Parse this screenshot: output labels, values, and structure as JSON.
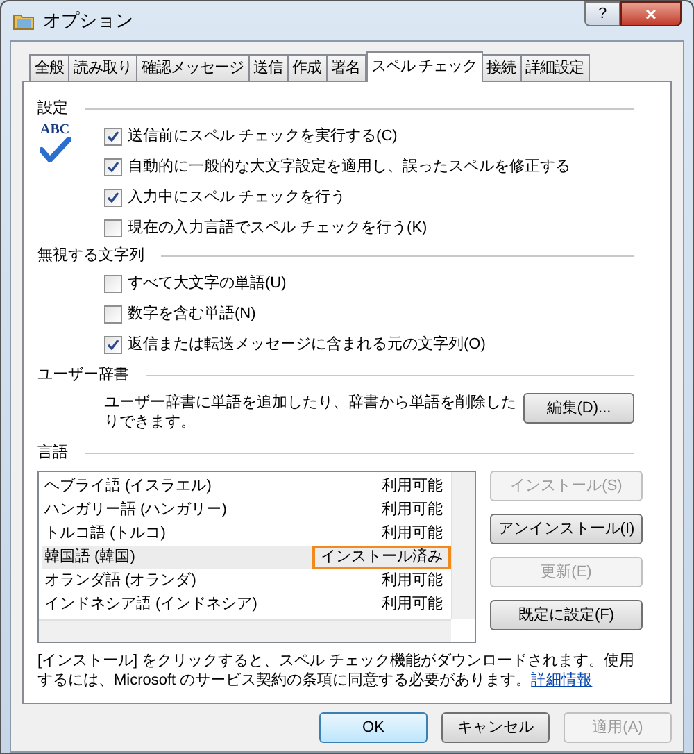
{
  "window": {
    "title": "オプション",
    "help": "?",
    "close": "×"
  },
  "tabs": [
    {
      "label": "全般",
      "selected": false
    },
    {
      "label": "読み取り",
      "selected": false
    },
    {
      "label": "確認メッセージ",
      "selected": false
    },
    {
      "label": "送信",
      "selected": false
    },
    {
      "label": "作成",
      "selected": false
    },
    {
      "label": "署名",
      "selected": false
    },
    {
      "label": "スペル チェック",
      "selected": true
    },
    {
      "label": "接続",
      "selected": false
    },
    {
      "label": "詳細設定",
      "selected": false
    }
  ],
  "settings": {
    "heading": "設定",
    "logo": "ABC",
    "options": [
      {
        "label": "送信前にスペル チェックを実行する(C)",
        "checked": true
      },
      {
        "label": "自動的に一般的な大文字設定を適用し、誤ったスペルを修正する",
        "checked": true
      },
      {
        "label": "入力中にスペル チェックを行う",
        "checked": true
      },
      {
        "label": "現在の入力言語でスペル チェックを行う(K)",
        "checked": false
      }
    ]
  },
  "ignore": {
    "heading": "無視する文字列",
    "options": [
      {
        "label": "すべて大文字の単語(U)",
        "checked": false
      },
      {
        "label": "数字を含む単語(N)",
        "checked": false
      },
      {
        "label": "返信または転送メッセージに含まれる元の文字列(O)",
        "checked": true
      }
    ]
  },
  "user_dictionary": {
    "heading": "ユーザー辞書",
    "description": "ユーザー辞書に単語を追加したり、辞書から単語を削除したりできます。",
    "button": "編集(D)..."
  },
  "languages": {
    "heading": "言語",
    "rows": [
      {
        "name": "ヘブライ語 (イスラエル)",
        "status": "利用可能",
        "selected": false,
        "annotated": false
      },
      {
        "name": "ハンガリー語 (ハンガリー)",
        "status": "利用可能",
        "selected": false,
        "annotated": false
      },
      {
        "name": "トルコ語 (トルコ)",
        "status": "利用可能",
        "selected": false,
        "annotated": false
      },
      {
        "name": "韓国語 (韓国)",
        "status": "インストール済み",
        "selected": true,
        "annotated": true
      },
      {
        "name": "オランダ語 (オランダ)",
        "status": "利用可能",
        "selected": false,
        "annotated": false
      },
      {
        "name": "インドネシア語 (インドネシア)",
        "status": "利用可能",
        "selected": false,
        "annotated": false
      }
    ],
    "buttons": [
      {
        "label": "インストール(S)",
        "disabled": true
      },
      {
        "label": "アンインストール(I)",
        "disabled": false
      },
      {
        "label": "更新(E)",
        "disabled": true
      },
      {
        "label": "既定に設定(F)",
        "disabled": false
      }
    ],
    "note": "[インストール] をクリックすると、スペル チェック機能がダウンロードされます。使用するには、Microsoft のサービス契約の条項に同意する必要があります。",
    "link": "詳細情報"
  },
  "footer_buttons": [
    {
      "label": "OK",
      "disabled": false,
      "default": true
    },
    {
      "label": "キャンセル",
      "disabled": false,
      "default": false
    },
    {
      "label": "適用(A)",
      "disabled": true,
      "default": false
    }
  ]
}
